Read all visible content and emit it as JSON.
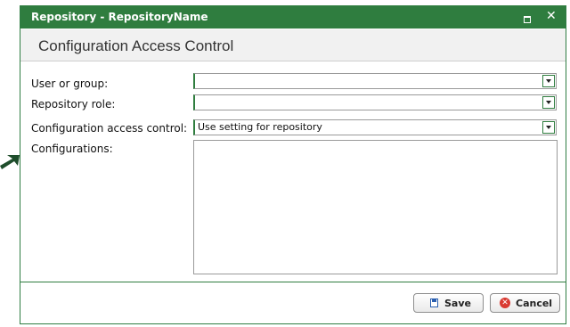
{
  "window": {
    "title": "Repository - RepositoryName",
    "maximize_icon": "maximize-icon",
    "close_icon": "close-icon",
    "close_glyph": "✕",
    "accent_color": "#2f7d3f"
  },
  "header": {
    "title": "Configuration Access Control"
  },
  "form": {
    "user_or_group": {
      "label": "User or group:",
      "value": ""
    },
    "repository_role": {
      "label": "Repository role:",
      "value": ""
    },
    "configuration_access_control": {
      "label": "Configuration access control:",
      "value": "Use setting for repository"
    },
    "configurations": {
      "label": "Configurations:",
      "value": ""
    }
  },
  "footer": {
    "save_label": "Save",
    "save_icon": "save-icon",
    "cancel_label": "Cancel",
    "cancel_icon": "cancel-icon",
    "cancel_glyph": "✕"
  }
}
